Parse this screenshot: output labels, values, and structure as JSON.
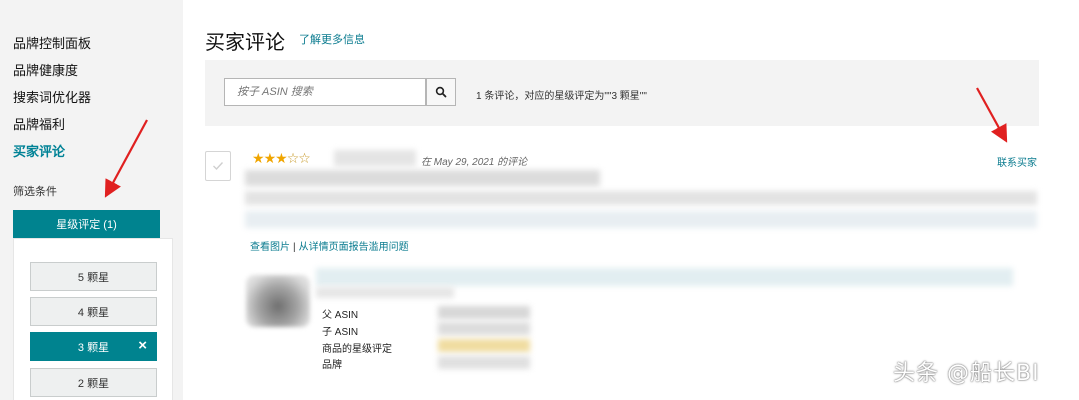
{
  "sidebar": {
    "nav": [
      {
        "label": "品牌控制面板",
        "active": false
      },
      {
        "label": "品牌健康度",
        "active": false
      },
      {
        "label": "搜索词优化器",
        "active": false
      },
      {
        "label": "品牌福利",
        "active": false
      },
      {
        "label": "买家评论",
        "active": true
      }
    ],
    "filter_title": "筛选条件",
    "filter_header": "星级评定 (1)",
    "star_options": [
      {
        "label": "5 颗星",
        "selected": false
      },
      {
        "label": "4 颗星",
        "selected": false
      },
      {
        "label": "3 颗星",
        "selected": true
      },
      {
        "label": "2 颗星",
        "selected": false
      }
    ],
    "clear_icon": "×"
  },
  "header": {
    "title": "买家评论",
    "more_link": "了解更多信息"
  },
  "search": {
    "placeholder": "按子 ASIN 搜索",
    "icon": "search-icon",
    "result_text": "1 条评论，对应的星级评定为\"\"3 颗星\"\""
  },
  "review": {
    "rating": 3,
    "max_rating": 5,
    "date_text": "在 May 29, 2021 的评论",
    "contact_link": "联系买家",
    "view_images": "查看图片",
    "separator": "|",
    "report_link": "从详情页面报告滥用问题",
    "meta_labels": [
      "父 ASIN",
      "子 ASIN",
      "商品的星级评定",
      "品牌"
    ]
  },
  "watermark": "头条 @船长BI",
  "colors": {
    "accent": "#00838f",
    "link": "#0a7b8f",
    "sidebar_bg": "#f3f3f3",
    "star": "#f0a500",
    "arrow": "#e02020"
  }
}
